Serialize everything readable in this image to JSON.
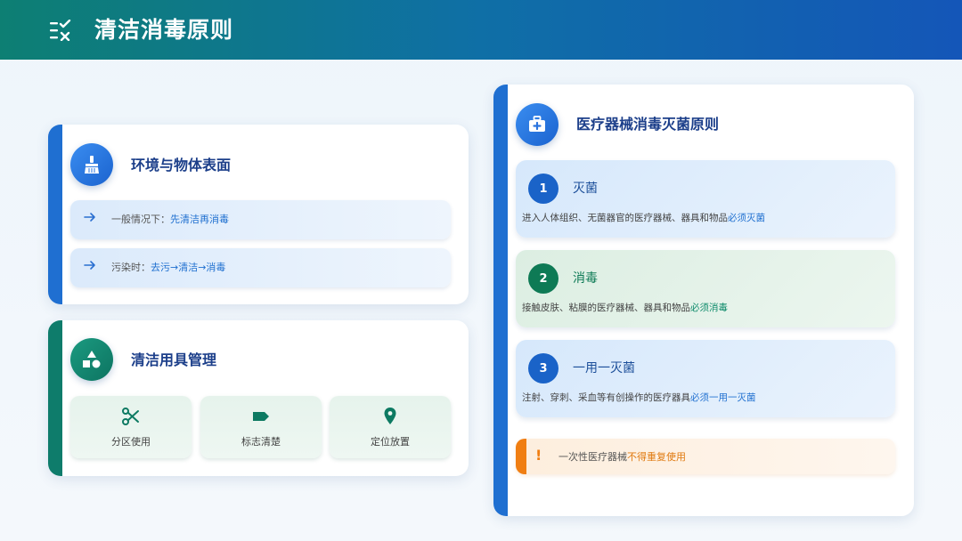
{
  "header": {
    "title": "清洁消毒原则",
    "icon": "checklist-icon"
  },
  "colors": {
    "header_start": "#0d7f73",
    "header_end": "#1456b8",
    "blue_accent": "#1f6fd1",
    "green_accent": "#0e7c6b",
    "orange_accent": "#f07e12"
  },
  "env_card": {
    "title": "环境与物体表面",
    "icon": "broom-icon",
    "rules": [
      {
        "prefix": "一般情况下：",
        "highlight": "先清洁再消毒"
      },
      {
        "prefix": "污染时：",
        "highlight": "去污→清洁→消毒"
      }
    ]
  },
  "tools_card": {
    "title": "清洁用具管理",
    "icon": "shapes-icon",
    "items": [
      {
        "label": "分区使用",
        "icon": "scissors-icon"
      },
      {
        "label": "标志清楚",
        "icon": "label-icon"
      },
      {
        "label": "定位放置",
        "icon": "location-pin-icon"
      }
    ]
  },
  "med_card": {
    "title": "医疗器械消毒灭菌原则",
    "icon": "medical-kit-icon",
    "principles": [
      {
        "num": "1",
        "title": "灭菌",
        "desc": "进入人体组织、无菌器官的医疗器械、器具和物品",
        "highlight": "必须灭菌"
      },
      {
        "num": "2",
        "title": "消毒",
        "desc": "接触皮肤、粘膜的医疗器械、器具和物品",
        "highlight": "必须消毒"
      },
      {
        "num": "3",
        "title": "一用一灭菌",
        "desc": "注射、穿刺、采血等有创操作的医疗器具",
        "highlight": "必须一用一灭菌"
      }
    ],
    "warning": {
      "icon": "!",
      "text": "一次性医疗器械",
      "highlight": "不得重复使用"
    }
  }
}
